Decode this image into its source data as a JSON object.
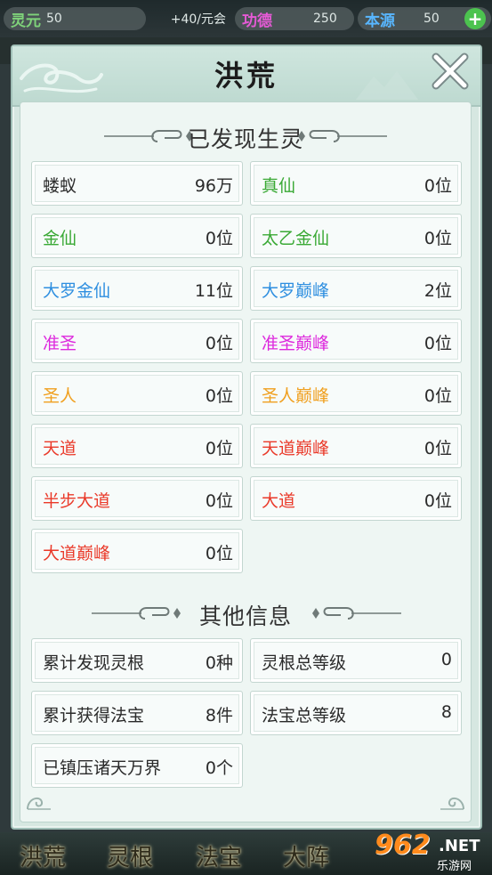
{
  "topbar": {
    "lingyuan": {
      "label": "灵元",
      "value": "50"
    },
    "rate": "+40/元会",
    "gongde": {
      "label": "功德",
      "value": "250"
    },
    "benyuan": {
      "label": "本源",
      "value": "50"
    }
  },
  "panel": {
    "title": "洪荒",
    "section1_title": "已发现生灵",
    "section2_title": "其他信息",
    "creatures": [
      {
        "name": "蝼蚁",
        "value": "96万",
        "color": "#2a2a2a"
      },
      {
        "name": "真仙",
        "value": "0位",
        "color": "#3aa935"
      },
      {
        "name": "金仙",
        "value": "0位",
        "color": "#3aa935"
      },
      {
        "name": "太乙金仙",
        "value": "0位",
        "color": "#3aa935"
      },
      {
        "name": "大罗金仙",
        "value": "11位",
        "color": "#2f8fe0"
      },
      {
        "name": "大罗巅峰",
        "value": "2位",
        "color": "#2f8fe0"
      },
      {
        "name": "准圣",
        "value": "0位",
        "color": "#dd28dd"
      },
      {
        "name": "准圣巅峰",
        "value": "0位",
        "color": "#dd28dd"
      },
      {
        "name": "圣人",
        "value": "0位",
        "color": "#f0a020"
      },
      {
        "name": "圣人巅峰",
        "value": "0位",
        "color": "#f0a020"
      },
      {
        "name": "天道",
        "value": "0位",
        "color": "#ea3a2a"
      },
      {
        "name": "天道巅峰",
        "value": "0位",
        "color": "#ea3a2a"
      },
      {
        "name": "半步大道",
        "value": "0位",
        "color": "#ea3a2a"
      },
      {
        "name": "大道",
        "value": "0位",
        "color": "#ea3a2a"
      },
      {
        "name": "大道巅峰",
        "value": "0位",
        "color": "#ea3a2a"
      }
    ],
    "other": [
      {
        "name": "累计发现灵根",
        "value": "0种"
      },
      {
        "name": "灵根总等级",
        "value": "0"
      },
      {
        "name": "累计获得法宝",
        "value": "8件"
      },
      {
        "name": "法宝总等级",
        "value": "8"
      },
      {
        "name": "已镇压诸天万界",
        "value": "0个"
      }
    ]
  },
  "bottom_nav": [
    "洪荒",
    "灵根",
    "法宝",
    "大阵"
  ],
  "watermark": {
    "brand": "962",
    "suffix": ".NET",
    "sub": "乐游网"
  }
}
